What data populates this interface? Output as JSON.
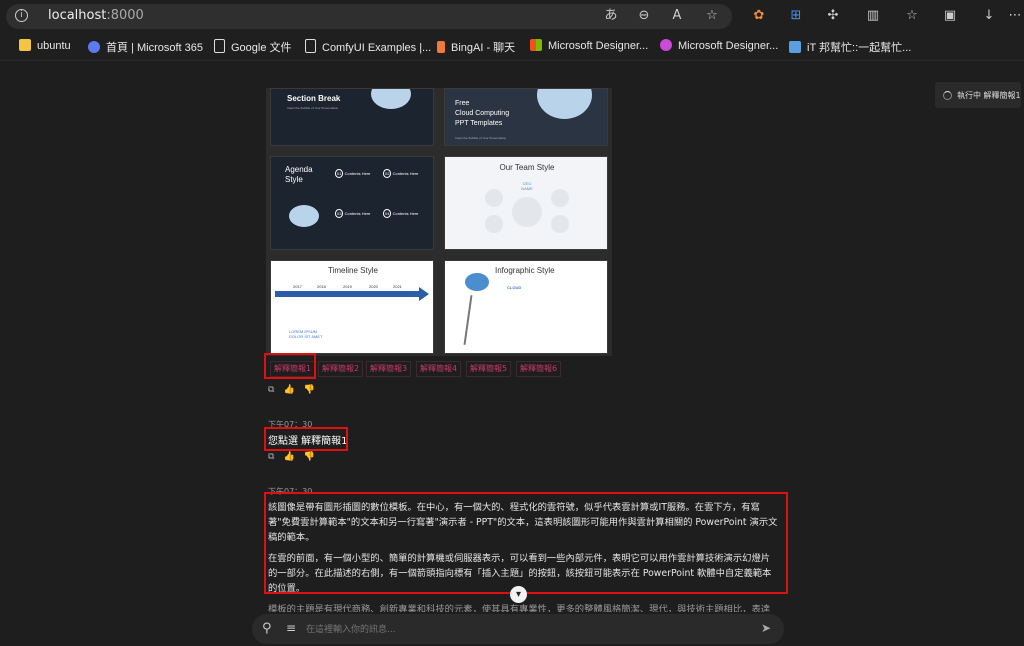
{
  "browser": {
    "url_host": "localhost",
    "url_port": ":8000",
    "bookmarks": [
      {
        "label": "ubuntu",
        "icon": "folder-icon",
        "color": "#f4c542"
      },
      {
        "label": "首頁 | Microsoft 365",
        "icon": "m365-icon",
        "color": "#5b7cf0"
      },
      {
        "label": "Google 文件",
        "icon": "doc-icon",
        "color": "#e8e8e8"
      },
      {
        "label": "ComfyUI Examples |...",
        "icon": "doc-icon",
        "color": "#e8e8e8"
      },
      {
        "label": "BingAI - 聊天",
        "icon": "bingai-icon",
        "color": "#f07a3a"
      },
      {
        "label": "Microsoft Designer...",
        "icon": "ms-logo-icon",
        "color": "#f25022"
      },
      {
        "label": "Microsoft Designer...",
        "icon": "designer-icon",
        "color": "#c94bd8"
      },
      {
        "label": "iT 邦幫忙::一起幫忙...",
        "icon": "ithome-icon",
        "color": "#5aa0e0"
      }
    ]
  },
  "status": {
    "label": "執行中 解釋簡報1"
  },
  "slides": [
    {
      "title": "Section Break",
      "subtitle": "Insert the Subtitle of Your Presentation",
      "theme": "dark"
    },
    {
      "title": "Free\nCloud Computing\nPPT Templates",
      "subtitle": "Insert the Subtitle of Your Presentation",
      "theme": "dark"
    },
    {
      "title": "Agenda\nStyle",
      "items": [
        "Contents Here",
        "Contents Here",
        "Contents Here",
        "Contents Here"
      ],
      "numbers": [
        "01",
        "02",
        "03",
        "04"
      ],
      "theme": "dark"
    },
    {
      "title": "Our Team Style",
      "center": "CEO\nNAME",
      "theme": "light"
    },
    {
      "title": "Timeline Style",
      "years": [
        "2017",
        "2018",
        "2019",
        "2020",
        "2021"
      ],
      "caption": "LOREM IPSUM\nDOLOR SIT AMET",
      "theme": "light"
    },
    {
      "title": "Infographic Style",
      "badge": "CLOUD",
      "theme": "light"
    }
  ],
  "tabs": [
    "解釋簡報1",
    "解釋簡報2",
    "解釋簡報3",
    "解釋簡報4",
    "解釋簡報5",
    "解釋簡報6"
  ],
  "messages": {
    "user_time": "下午07：30",
    "user_text": "您點選 解釋簡報1",
    "bot_time": "下午07：30",
    "bot_paragraphs": [
      "該圖像是帶有圖形插圖的數位模板。在中心，有一個大的、程式化的雲符號，似乎代表雲計算或IT服務。在雲下方，有寫著\"免費雲計算範本\"的文本和另一行寫著\"演示者 - PPT\"的文本，這表明該圖形可能用作與雲計算相關的 PowerPoint 演示文稿的範本。",
      "在雲的前面，有一個小型的、簡單的計算機或伺服器表示，可以看到一些內部元件，表明它可以用作雲計算技術演示幻燈片的一部分。在此描述的右側，有一個箭頭指向標有「插入主題」的按鈕，該按鈕可能表示在 PowerPoint 軟體中自定義範本的位置。"
    ],
    "bot_cut_text": "模板的主題是有現代商務、創新專業和科技的元素，使其具有專業性，更多的整體風格簡潔、現代，與技術主題相比，表達出高度先進。"
  },
  "composer": {
    "placeholder": "在這裡輸入你的訊息..."
  }
}
